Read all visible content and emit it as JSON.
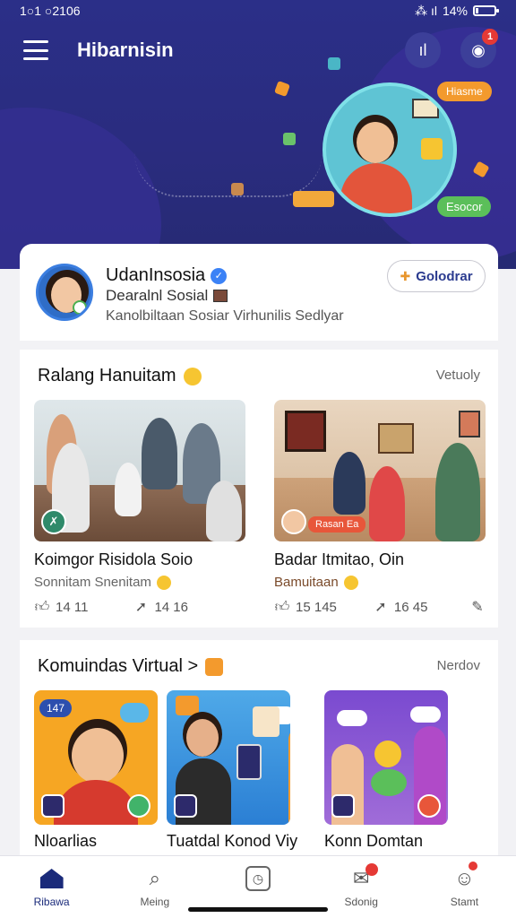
{
  "status_bar": {
    "time": "1○1 ○2106",
    "battery": "14%",
    "battery_level": 0.14
  },
  "app_bar": {
    "title": "Hibarnisin"
  },
  "hero": {
    "chip_top": "Hiasme",
    "chip_bottom": "Esocor"
  },
  "profile": {
    "name": "UdanInsosia",
    "subtitle": "Dearalnl Sosial",
    "description": "Kanolbiltaan Sosiar  Virhunilis Sedlyar",
    "follow_label": "Golodrar"
  },
  "section_rang": {
    "title": "Ralang Hanuitam",
    "link": "Vetuoly",
    "posts": [
      {
        "title": "Koimgor Risidola Soio",
        "subtitle": "Sonnitam Snenitam",
        "likes": "14 11",
        "shares": "14 16"
      },
      {
        "title": "Badar Itmitao, Oin",
        "subtitle": "Bamuitaan",
        "chip": "Rasan Ea",
        "likes": "15 145",
        "shares": "16 45"
      }
    ]
  },
  "section_komunitas": {
    "title": "Komuindas  Virtual >",
    "link": "Nerdov",
    "items": [
      {
        "title": "Nloarlias",
        "bubble": "147"
      },
      {
        "title": "Tuatdal Konod Viy"
      },
      {
        "title": "Konn Domtan"
      }
    ]
  },
  "bottom_nav": [
    {
      "label": "Ribawa",
      "icon": "home-icon"
    },
    {
      "label": "Meing",
      "icon": "search-icon"
    },
    {
      "label": "",
      "icon": "clock-icon"
    },
    {
      "label": "Sdonig",
      "icon": "chat-icon"
    },
    {
      "label": "Stamt",
      "icon": "profile-icon"
    }
  ]
}
